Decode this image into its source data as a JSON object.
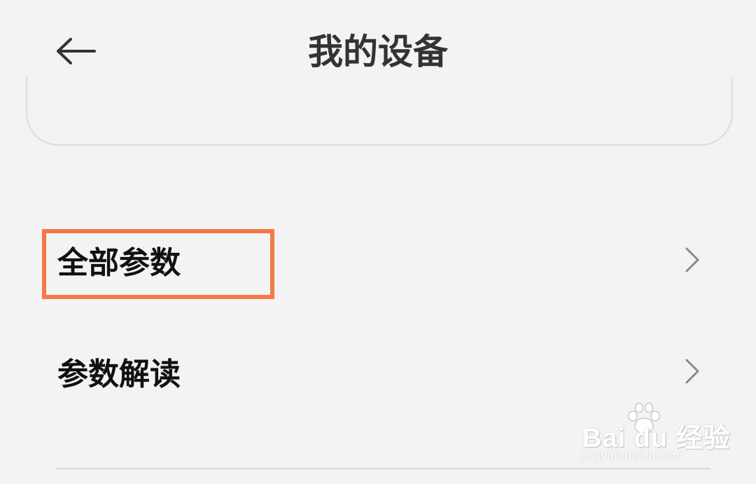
{
  "header": {
    "back_icon": "arrow-left-icon",
    "title": "我的设备"
  },
  "list": {
    "items": [
      {
        "label": "全部参数",
        "chevron_icon": "chevron-right-icon",
        "highlighted": true
      },
      {
        "label": "参数解读",
        "chevron_icon": "chevron-right-icon",
        "highlighted": false
      }
    ]
  },
  "annotation": {
    "highlight_color": "#f47a42"
  },
  "watermark": {
    "brand": "Bai du 经验",
    "url": "jingyan.baidu.com",
    "icon": "paw-icon"
  },
  "colors": {
    "background": "#f3f3f3",
    "title_text": "#333333",
    "item_text": "#111111",
    "chevron": "#8a8a8a",
    "divider": "#d6d6d6"
  }
}
